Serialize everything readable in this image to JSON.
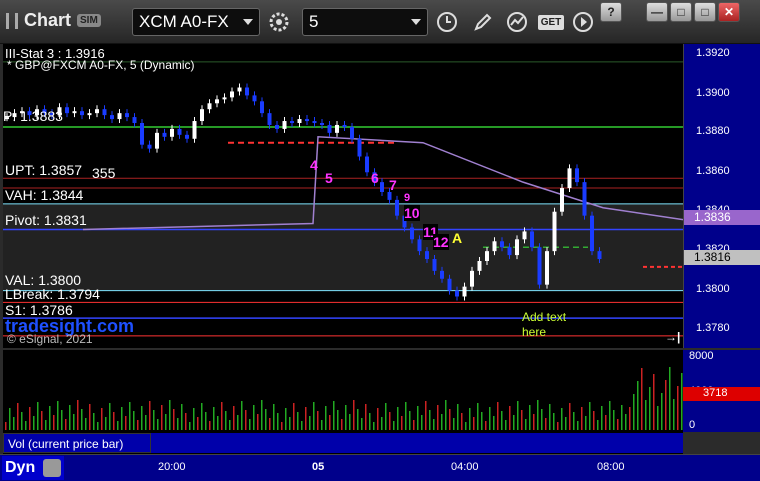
{
  "window": {
    "title": "Chart",
    "badge": "SIM",
    "symbol": "XCM A0-FX",
    "interval": "5",
    "get_label": "GET",
    "win_help": "?",
    "win_min": "—",
    "win_max": "□",
    "win_close": "✕"
  },
  "chart": {
    "header_line1": "III-Stat 3 : 1.3916",
    "header_line2": "* GBP@FXCM A0-FX, 5 (Dynamic)",
    "watermark": "tradesight.com",
    "copyright": "© eSignal, 2021",
    "levels": [
      {
        "text": "P: 1.3883",
        "color": "#ffffff"
      },
      {
        "text": "UPT: 1.3857",
        "color": "#ffffff"
      },
      {
        "text": "355",
        "color": "#ffffff"
      },
      {
        "text": "VAH: 1.3844",
        "color": "#ffffff"
      },
      {
        "text": "Pivot: 1.3831",
        "color": "#ffffff"
      },
      {
        "text": "VAL: 1.3800",
        "color": "#ffffff"
      },
      {
        "text": "LBreak: 1.3794",
        "color": "#ffffff"
      },
      {
        "text": "S1: 1.3786",
        "color": "#ffffff"
      }
    ],
    "counts": {
      "c4": "4",
      "c5": "5",
      "c6": "6",
      "c7": "7",
      "c9": "9",
      "c10": "10",
      "c11": "11",
      "c12": "12",
      "ca": "A"
    },
    "annotation": "Add text\nhere",
    "price_ticks": [
      "1.3920",
      "1.3900",
      "1.3880",
      "1.3860",
      "1.3840",
      "1.3820",
      "1.3800",
      "1.3780"
    ],
    "price_tag_1": "1.3836",
    "price_tag_2": "1.3816",
    "last_marker": "→|"
  },
  "volume": {
    "ticks": [
      "8000",
      "4000",
      "0"
    ],
    "last": "3718",
    "label": "Vol (current price bar)"
  },
  "time_axis": {
    "tab_label": "Dyn",
    "ticks": [
      "20:00",
      "05",
      "04:00",
      "08:00"
    ]
  },
  "colors": {
    "price_up": "#ffffff",
    "price_down": "#1a3cff",
    "accent_magenta": "#ff33ff",
    "accent_green": "#33cc33",
    "level_red": "#ff3333",
    "level_cyan": "#7fe5ff",
    "axis_bg": "#00008b"
  }
}
